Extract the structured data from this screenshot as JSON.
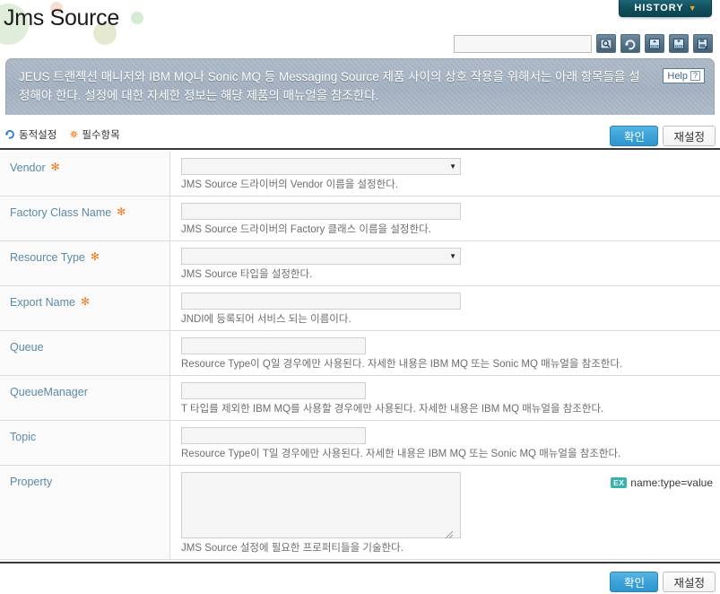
{
  "header": {
    "title": "Jms Source",
    "history_tab": {
      "label": "HISTORY",
      "chevron": "chevron-down-icon"
    },
    "search": {
      "value": "",
      "placeholder": ""
    },
    "toolbar_icons": [
      {
        "name": "search-icon"
      },
      {
        "name": "refresh-icon"
      },
      {
        "name": "xml-upload-icon"
      },
      {
        "name": "xml-download-icon"
      },
      {
        "name": "save-export-icon"
      }
    ]
  },
  "banner": {
    "text": "JEUS 트랜젝션 매니저와 IBM MQ나 Sonic MQ 등 Messaging Source 제품 사이의 상호 작용을 위해서는 아래 항목들을 설정해야 한다. 설정에 대한 자세한 정보는 해당 제품의 매뉴얼을 참조한다.",
    "help_label": "Help",
    "help_icon": "question-mark-icon"
  },
  "legend": {
    "dynamic": {
      "icon": "refresh-icon",
      "label": "동적설정"
    },
    "required": {
      "icon": "asterisk-icon",
      "label": "필수항목"
    }
  },
  "actions": {
    "confirm_label": "확인",
    "reset_label": "재설정"
  },
  "colors": {
    "accent_blue": "#3ca3d8",
    "label_blue": "#5b89a8",
    "required_orange": "#f07818",
    "banner_bg": "#9fadbd",
    "history_bg": "#12505e",
    "ex_badge": "#38b2ac"
  },
  "form": {
    "rows": [
      {
        "label": "Vendor",
        "required": true,
        "control": "select",
        "value": "",
        "description": "JMS Source 드라이버의 Vendor 이름을 설정한다."
      },
      {
        "label": "Factory Class Name",
        "required": true,
        "control": "input",
        "value": "",
        "description": "JMS Source 드라이버의 Factory 클래스 이름을 설정한다."
      },
      {
        "label": "Resource Type",
        "required": true,
        "control": "select",
        "value": "",
        "description": "JMS Source 타입을 설정한다."
      },
      {
        "label": "Export Name",
        "required": true,
        "control": "input",
        "value": "",
        "description": "JNDI에 등록되어 서비스 되는 이름이다."
      },
      {
        "label": "Queue",
        "required": false,
        "control": "input-narrow",
        "value": "",
        "description": "Resource Type이 Q일 경우에만 사용된다. 자세한 내용은 IBM MQ 또는 Sonic MQ 매뉴얼을 참조한다."
      },
      {
        "label": "QueueManager",
        "required": false,
        "control": "input-narrow",
        "value": "",
        "description": "T 타입를 제외한 IBM MQ를 사용할 경우에만 사용된다. 자세한 내용은 IBM MQ 매뉴얼을 참조한다."
      },
      {
        "label": "Topic",
        "required": false,
        "control": "input-narrow",
        "value": "",
        "description": "Resource Type이 T일 경우에만 사용된다. 자세한 내용은 IBM MQ 또는 Sonic MQ 매뉴얼을 참조한다."
      },
      {
        "label": "Property",
        "required": false,
        "control": "textarea",
        "value": "",
        "description": "JMS Source 설정에 필요한 프로퍼티들을 기술한다.",
        "example_badge": "EX",
        "example_text": "name:type=value"
      }
    ]
  }
}
